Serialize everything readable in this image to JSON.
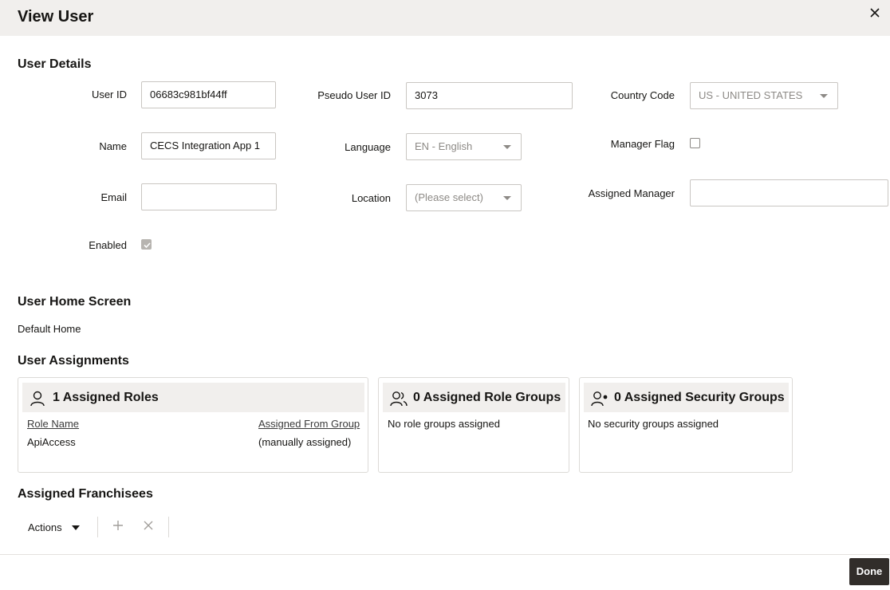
{
  "window": {
    "title": "View User"
  },
  "sections": {
    "user_details": "User Details",
    "home_screen": "User Home Screen",
    "assignments": "User Assignments",
    "franchisees": "Assigned Franchisees"
  },
  "fields": {
    "user_id": {
      "label": "User ID",
      "value": "06683c981bf44ff"
    },
    "name": {
      "label": "Name",
      "value": "CECS Integration App 1"
    },
    "email": {
      "label": "Email",
      "value": ""
    },
    "enabled": {
      "label": "Enabled",
      "checked": true
    },
    "pseudo_user_id": {
      "label": "Pseudo User ID",
      "value": "3073"
    },
    "language": {
      "label": "Language",
      "value": "EN - English"
    },
    "location": {
      "label": "Location",
      "value": "(Please select)"
    },
    "country_code": {
      "label": "Country Code",
      "value": "US - UNITED STATES"
    },
    "manager_flag": {
      "label": "Manager Flag",
      "checked": false
    },
    "assigned_manager": {
      "label": "Assigned Manager",
      "value": ""
    }
  },
  "home_screen": {
    "value": "Default Home"
  },
  "cards": {
    "roles": {
      "title": "1 Assigned Roles",
      "col_role": "Role Name",
      "col_group": "Assigned From Group",
      "rows": [
        {
          "role": "ApiAccess",
          "group": "(manually assigned)"
        }
      ]
    },
    "role_groups": {
      "title": "0 Assigned Role Groups",
      "empty": "No role groups assigned"
    },
    "security_groups": {
      "title": "0 Assigned Security Groups",
      "empty": "No security groups assigned"
    }
  },
  "toolbar": {
    "actions_label": "Actions"
  },
  "footer": {
    "done_label": "Done"
  },
  "icons": [
    "close-icon",
    "person-icon",
    "people-icon",
    "person-add-icon",
    "chevron-down-icon",
    "plus-icon",
    "x-icon",
    "check-icon"
  ]
}
